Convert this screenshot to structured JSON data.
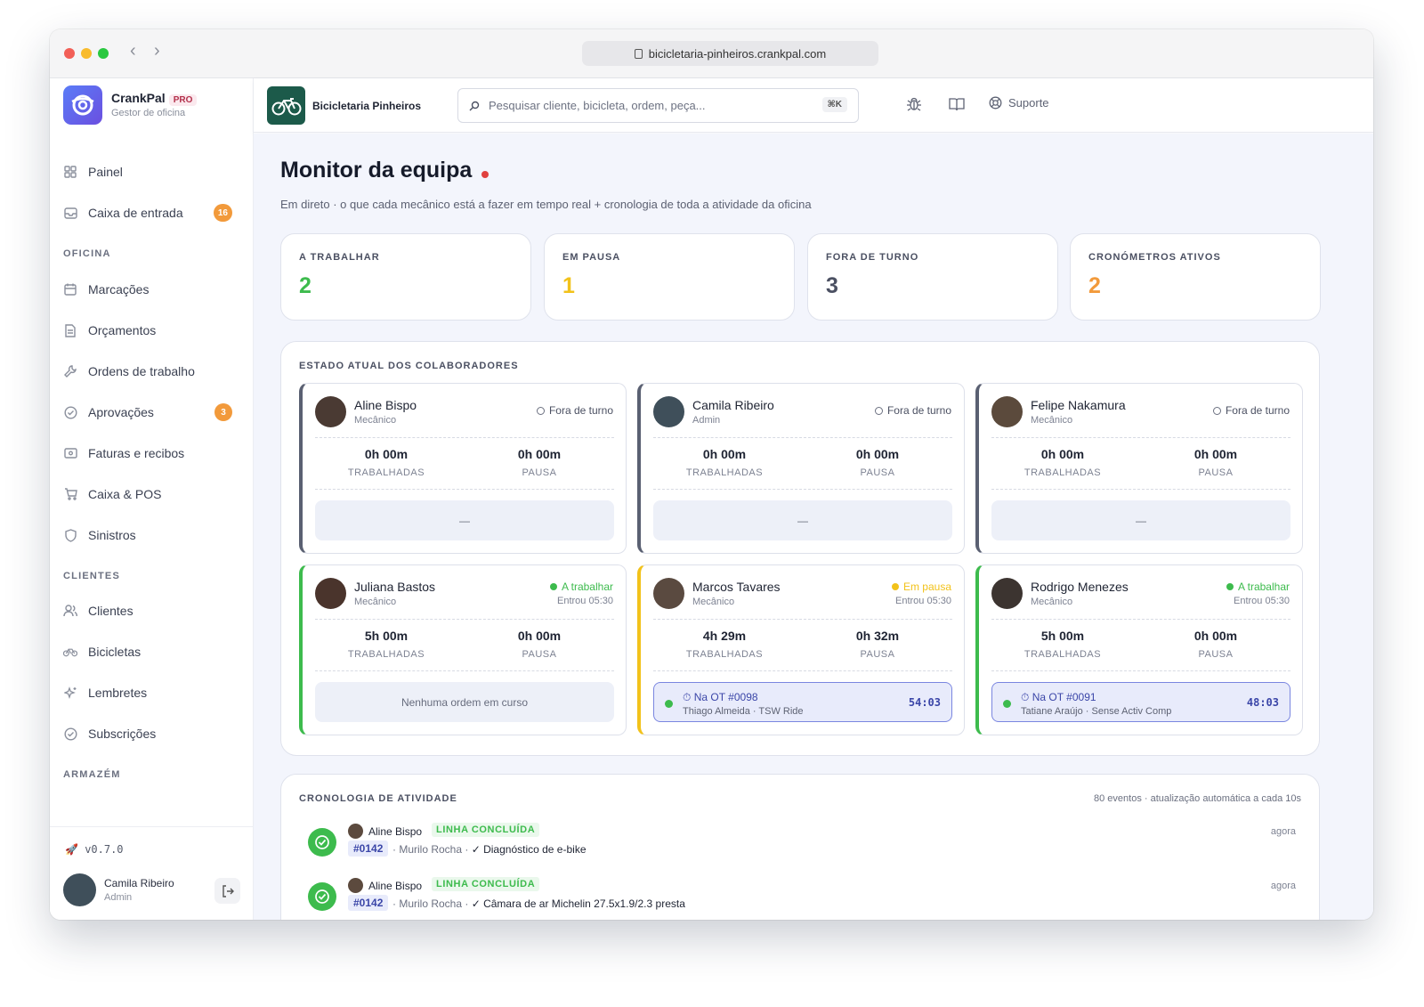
{
  "browser": {
    "url": "bicicletaria-pinheiros.crankpal.com"
  },
  "brand": {
    "name": "CrankPal",
    "badge": "PRO",
    "subtitle": "Gestor de oficina"
  },
  "sidebar": {
    "items": [
      {
        "label": "Painel",
        "icon": "grid-icon"
      },
      {
        "label": "Caixa de entrada",
        "icon": "inbox-icon",
        "badge": "16"
      }
    ],
    "sections": [
      {
        "title": "OFICINA",
        "items": [
          {
            "label": "Marcações",
            "icon": "calendar-icon"
          },
          {
            "label": "Orçamentos",
            "icon": "document-icon"
          },
          {
            "label": "Ordens de trabalho",
            "icon": "wrench-icon"
          },
          {
            "label": "Aprovações",
            "icon": "check-circle-icon",
            "badge": "3"
          },
          {
            "label": "Faturas e recibos",
            "icon": "receipt-icon"
          },
          {
            "label": "Caixa & POS",
            "icon": "cart-icon"
          },
          {
            "label": "Sinistros",
            "icon": "shield-icon"
          }
        ]
      },
      {
        "title": "CLIENTES",
        "items": [
          {
            "label": "Clientes",
            "icon": "users-icon"
          },
          {
            "label": "Bicicletas",
            "icon": "bicycle-icon"
          },
          {
            "label": "Lembretes",
            "icon": "sparkle-icon"
          },
          {
            "label": "Subscrições",
            "icon": "check-circle-icon"
          }
        ]
      },
      {
        "title": "ARMAZÉM",
        "items": []
      }
    ],
    "version": "v0.7.0",
    "user": {
      "name": "Camila Ribeiro",
      "role": "Admin"
    }
  },
  "header": {
    "shop_name": "Bicicletaria Pinheiros",
    "search_placeholder": "Pesquisar cliente, bicicleta, ordem, peça...",
    "search_shortcut": "⌘K",
    "support_label": "Suporte"
  },
  "page": {
    "title": "Monitor da equipa",
    "subtitle": "Em direto · o que cada mecânico está a fazer em tempo real + cronologia de toda a atividade da oficina"
  },
  "stats": [
    {
      "label": "A TRABALHAR",
      "value": "2",
      "color": "#3dbb4d"
    },
    {
      "label": "EM PAUSA",
      "value": "1",
      "color": "#f2c21a"
    },
    {
      "label": "FORA DE TURNO",
      "value": "3",
      "color": "#4b5062"
    },
    {
      "label": "CRONÓMETROS ATIVOS",
      "value": "2",
      "color": "#f29a3b"
    }
  ],
  "team": {
    "title": "ESTADO ATUAL DOS COLABORADORES",
    "worked_label": "TRABALHADAS",
    "pause_label": "PAUSA",
    "members": [
      {
        "name": "Aline Bispo",
        "role": "Mecânico",
        "status": "Fora de turno",
        "worked": "0h 00m",
        "pause": "0h 00m",
        "task": "—"
      },
      {
        "name": "Camila Ribeiro",
        "role": "Admin",
        "status": "Fora de turno",
        "worked": "0h 00m",
        "pause": "0h 00m",
        "task": "—"
      },
      {
        "name": "Felipe Nakamura",
        "role": "Mecânico",
        "status": "Fora de turno",
        "worked": "0h 00m",
        "pause": "0h 00m",
        "task": "—"
      },
      {
        "name": "Juliana Bastos",
        "role": "Mecânico",
        "status": "A trabalhar",
        "entered": "Entrou 05:30",
        "worked": "5h 00m",
        "pause": "0h 00m",
        "task": "Nenhuma ordem em curso"
      },
      {
        "name": "Marcos Tavares",
        "role": "Mecânico",
        "status": "Em pausa",
        "entered": "Entrou 05:30",
        "worked": "4h 29m",
        "pause": "0h 32m",
        "ot": "Na OT #0098",
        "ot_detail": "Thiago Almeida · TSW Ride",
        "timer": "54:03"
      },
      {
        "name": "Rodrigo Menezes",
        "role": "Mecânico",
        "status": "A trabalhar",
        "entered": "Entrou 05:30",
        "worked": "5h 00m",
        "pause": "0h 00m",
        "ot": "Na OT #0091",
        "ot_detail": "Tatiane Araújo · Sense Activ Comp",
        "timer": "48:03"
      }
    ]
  },
  "feed": {
    "title": "CRONOLOGIA DE ATIVIDADE",
    "meta": "80 eventos · atualização automática a cada 10s",
    "events": [
      {
        "name": "Aline Bispo",
        "tag": "LINHA CONCLUÍDA",
        "ot": "#0142",
        "client": "· Murilo Rocha ·",
        "text": "✓ Diagnóstico de e-bike",
        "time": "agora"
      },
      {
        "name": "Aline Bispo",
        "tag": "LINHA CONCLUÍDA",
        "ot": "#0142",
        "client": "· Murilo Rocha ·",
        "text": "✓ Câmara de ar Michelin 27.5x1.9/2.3 presta",
        "time": "agora"
      }
    ]
  }
}
